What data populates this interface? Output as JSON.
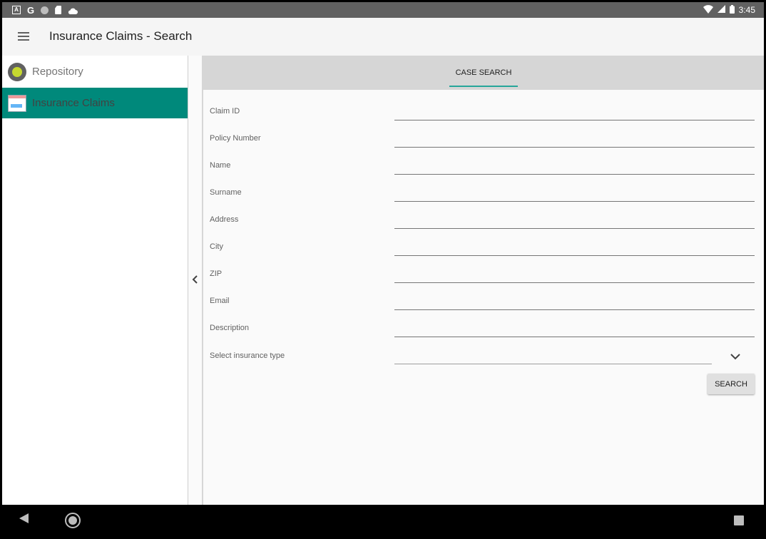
{
  "status_bar": {
    "notification_icons": [
      "a-notification-icon",
      "google-icon",
      "circle-notification-icon",
      "sd-card-icon",
      "cloud-icon"
    ],
    "google_glyph": "G",
    "a_glyph": "A",
    "time": "3:45"
  },
  "toolbar": {
    "title": "Insurance Claims - Search"
  },
  "sidebar": {
    "items": [
      {
        "label": "Repository",
        "icon": "repository-icon",
        "active": false
      },
      {
        "label": "Insurance Claims",
        "icon": "insurance-claims-icon",
        "active": true
      }
    ]
  },
  "main": {
    "tabs": [
      {
        "label": "CASE SEARCH",
        "active": true
      }
    ],
    "fields": [
      {
        "label": "Claim ID",
        "value": ""
      },
      {
        "label": "Policy Number",
        "value": ""
      },
      {
        "label": "Name",
        "value": ""
      },
      {
        "label": "Surname",
        "value": ""
      },
      {
        "label": "Address",
        "value": ""
      },
      {
        "label": "City",
        "value": ""
      },
      {
        "label": "ZIP",
        "value": ""
      },
      {
        "label": "Email",
        "value": ""
      },
      {
        "label": "Description",
        "value": ""
      }
    ],
    "select": {
      "label": "Select insurance type",
      "value": ""
    },
    "search_button": "SEARCH"
  },
  "colors": {
    "accent": "#00897b",
    "tab_indicator": "#26a69a",
    "status_bar": "#616161"
  }
}
